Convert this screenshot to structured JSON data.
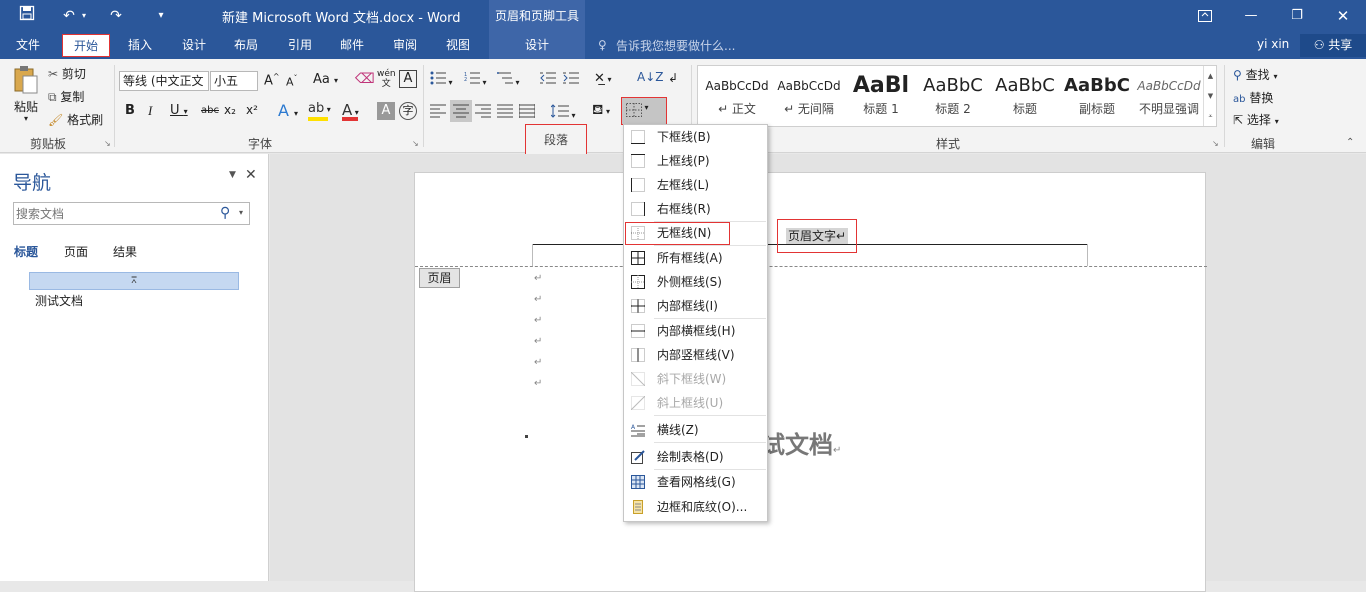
{
  "titlebar": {
    "title": "新建 Microsoft Word 文档.docx - Word",
    "context_title": "页眉和页脚工具",
    "save_icon": "save-icon",
    "undo_icon": "undo-icon",
    "redo_icon": "redo-icon",
    "customize_icon": "customize-qat-icon",
    "ribbon_options_icon": "ribbon-display-options-icon",
    "minimize_icon": "minimize-icon",
    "restore_icon": "restore-icon",
    "close_icon": "close-icon",
    "bg_color": "#2b579a"
  },
  "tabs": {
    "file": "文件",
    "home": "开始",
    "insert": "插入",
    "design": "设计",
    "layout": "布局",
    "references": "引用",
    "mailings": "邮件",
    "review": "审阅",
    "view": "视图",
    "hf_design": "设计",
    "tellme": "告诉我您想要做什么...",
    "user": "yi xin",
    "share": "共享"
  },
  "ribbon": {
    "clipboard": {
      "paste": "粘贴",
      "cut": "剪切",
      "copy": "复制",
      "format_painter": "格式刷",
      "label": "剪贴板"
    },
    "font": {
      "font_name": "等线 (中文正文",
      "font_size": "小五",
      "grow": "A",
      "shrink": "A",
      "case": "Aa",
      "bold": "B",
      "italic": "I",
      "underline": "U",
      "strike": "abc",
      "subscript": "x₂",
      "superscript": "x²",
      "label": "字体",
      "font_color": "#e23434",
      "highlight_color": "#ffe000"
    },
    "paragraph": {
      "label": "段落"
    },
    "styles": {
      "label": "样式",
      "items": [
        {
          "preview": "AaBbCcDd",
          "name": "↵ 正文"
        },
        {
          "preview": "AaBbCcDd",
          "name": "↵ 无间隔"
        },
        {
          "preview": "AaBl",
          "name": "标题 1"
        },
        {
          "preview": "AaBbC",
          "name": "标题 2"
        },
        {
          "preview": "AaBbC",
          "name": "标题"
        },
        {
          "preview": "AaBbC",
          "name": "副标题"
        },
        {
          "preview": "AaBbCcDd",
          "name": "不明显强调"
        }
      ]
    },
    "editing": {
      "find": "查找",
      "replace": "替换",
      "select": "选择",
      "label": "编辑"
    }
  },
  "nav": {
    "title": "导航",
    "search_placeholder": "搜索文档",
    "tab_headings": "标题",
    "tab_pages": "页面",
    "tab_results": "结果",
    "heading_item": "测试文档",
    "accent": "#2b579a"
  },
  "document": {
    "header_text": "页眉文字↵",
    "header_tag": "页眉",
    "body_title": "测试文档",
    "para_mark": "↵"
  },
  "border_menu": {
    "items": [
      {
        "label": "下框线(B)",
        "icon": "bottom-border-icon",
        "disabled": false
      },
      {
        "label": "上框线(P)",
        "icon": "top-border-icon",
        "disabled": false
      },
      {
        "label": "左框线(L)",
        "icon": "left-border-icon",
        "disabled": false
      },
      {
        "label": "右框线(R)",
        "icon": "right-border-icon",
        "disabled": false
      },
      {
        "label": "无框线(N)",
        "icon": "no-border-icon",
        "disabled": false
      },
      {
        "label": "所有框线(A)",
        "icon": "all-borders-icon",
        "disabled": false
      },
      {
        "label": "外侧框线(S)",
        "icon": "outside-borders-icon",
        "disabled": false
      },
      {
        "label": "内部框线(I)",
        "icon": "inside-borders-icon",
        "disabled": false
      },
      {
        "label": "内部横框线(H)",
        "icon": "inside-horizontal-border-icon",
        "disabled": false
      },
      {
        "label": "内部竖框线(V)",
        "icon": "inside-vertical-border-icon",
        "disabled": false
      },
      {
        "label": "斜下框线(W)",
        "icon": "diagonal-down-border-icon",
        "disabled": true
      },
      {
        "label": "斜上框线(U)",
        "icon": "diagonal-up-border-icon",
        "disabled": true
      },
      {
        "label": "横线(Z)",
        "icon": "horizontal-line-icon",
        "disabled": false
      },
      {
        "label": "绘制表格(D)",
        "icon": "draw-table-icon",
        "disabled": false
      },
      {
        "label": "查看网格线(G)",
        "icon": "view-gridlines-icon",
        "disabled": false
      },
      {
        "label": "边框和底纹(O)...",
        "icon": "borders-shading-icon",
        "disabled": false
      }
    ]
  }
}
